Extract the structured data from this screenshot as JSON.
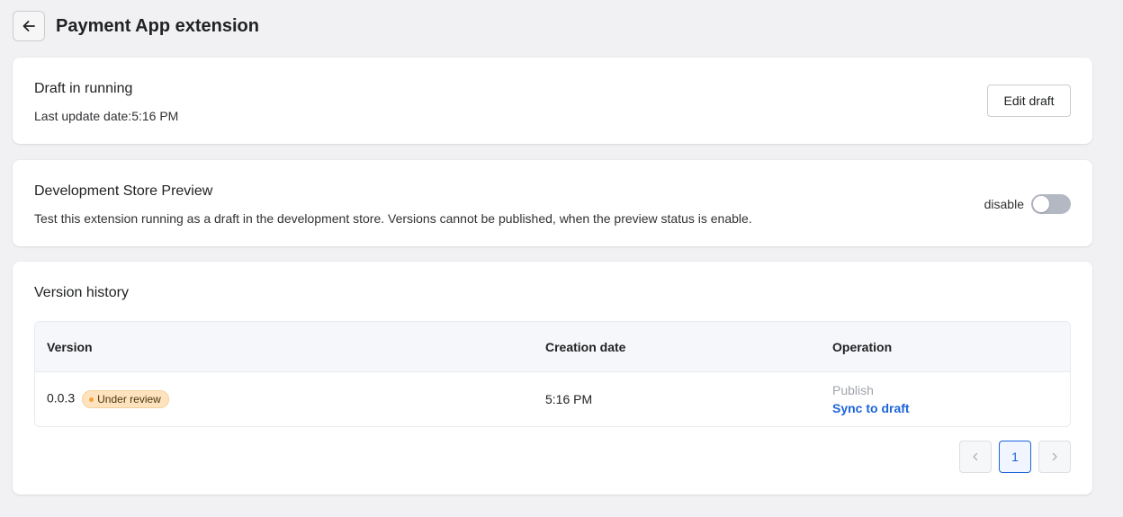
{
  "header": {
    "title": "Payment App extension",
    "back_icon": "arrow-left-icon"
  },
  "draft": {
    "title": "Draft in running",
    "last_update": "Last update date:5:16 PM",
    "edit_label": "Edit draft"
  },
  "preview": {
    "title": "Development Store Preview",
    "description": "Test this extension running as a draft in the development store. Versions cannot be published, when the preview status is enable.",
    "toggle_label": "disable",
    "toggle_on": false
  },
  "history": {
    "title": "Version history",
    "columns": [
      "Version",
      "Creation date",
      "Operation"
    ],
    "rows": [
      {
        "version": "0.0.3",
        "status": "Under review",
        "created": "5:16 PM",
        "publish": "Publish",
        "sync": "Sync to draft"
      }
    ],
    "pagination": {
      "current": "1",
      "prev_icon": "chevron-left-icon",
      "next_icon": "chevron-right-icon"
    }
  },
  "colors": {
    "accent": "#1c64d8",
    "badge_bg": "#ffe3bf",
    "badge_dot": "#f0a33b",
    "toggle_off": "#b4b8c2"
  }
}
